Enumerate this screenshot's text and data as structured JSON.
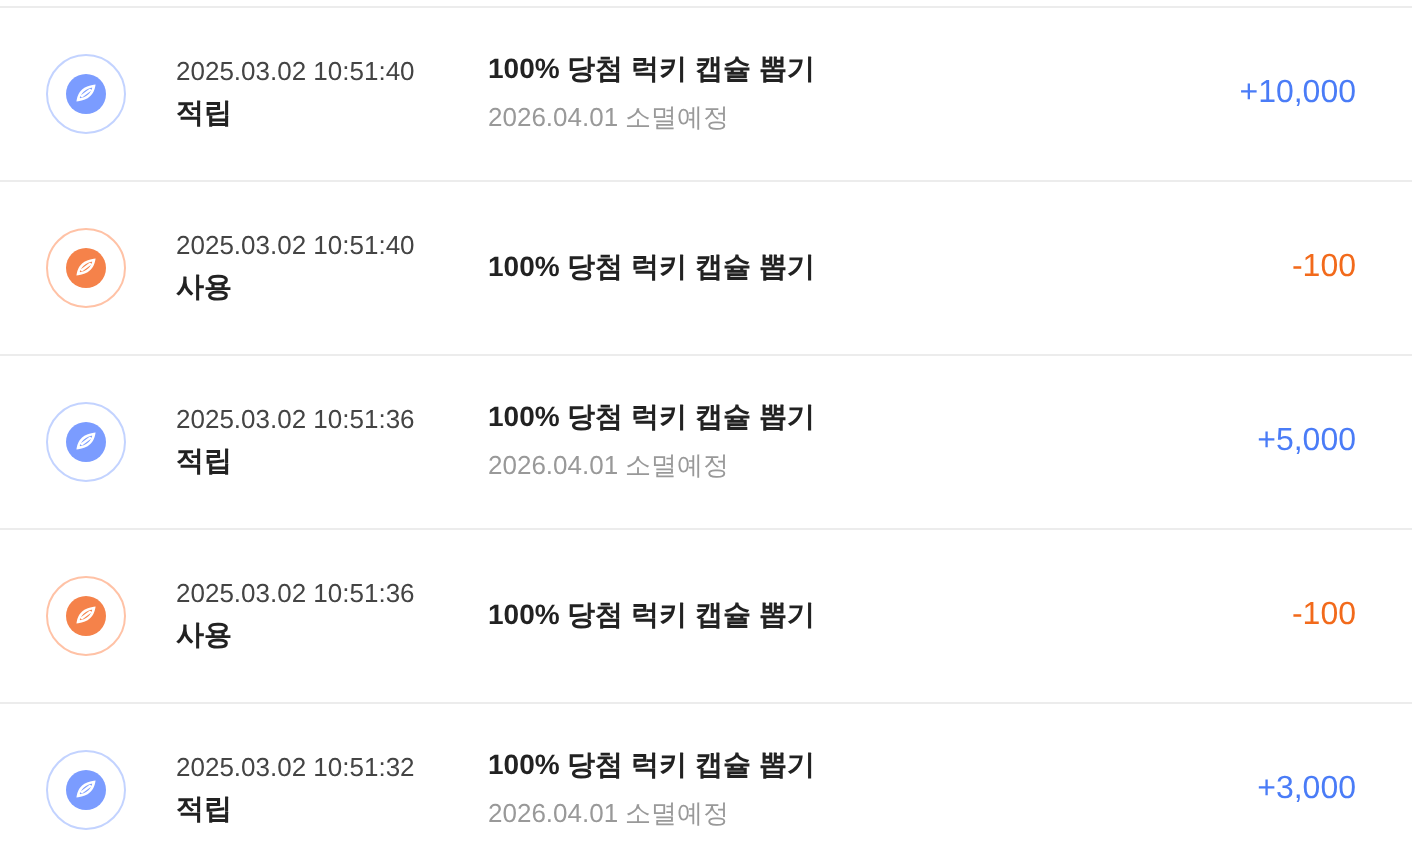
{
  "transactions": [
    {
      "kind": "earn",
      "datetime": "2025.03.02 10:51:40",
      "type_label": "적립",
      "title": "100% 당첨 럭키 캡슐 뽑기",
      "expiry": "2026.04.01 소멸예정",
      "amount": "+10,000"
    },
    {
      "kind": "use",
      "datetime": "2025.03.02 10:51:40",
      "type_label": "사용",
      "title": "100% 당첨 럭키 캡슐 뽑기",
      "amount": "-100"
    },
    {
      "kind": "earn",
      "datetime": "2025.03.02 10:51:36",
      "type_label": "적립",
      "title": "100% 당첨 럭키 캡슐 뽑기",
      "expiry": "2026.04.01 소멸예정",
      "amount": "+5,000"
    },
    {
      "kind": "use",
      "datetime": "2025.03.02 10:51:36",
      "type_label": "사용",
      "title": "100% 당첨 럭키 캡슐 뽑기",
      "amount": "-100"
    },
    {
      "kind": "earn",
      "datetime": "2025.03.02 10:51:32",
      "type_label": "적립",
      "title": "100% 당첨 럭키 캡슐 뽑기",
      "expiry": "2026.04.01 소멸예정",
      "amount": "+3,000"
    }
  ]
}
